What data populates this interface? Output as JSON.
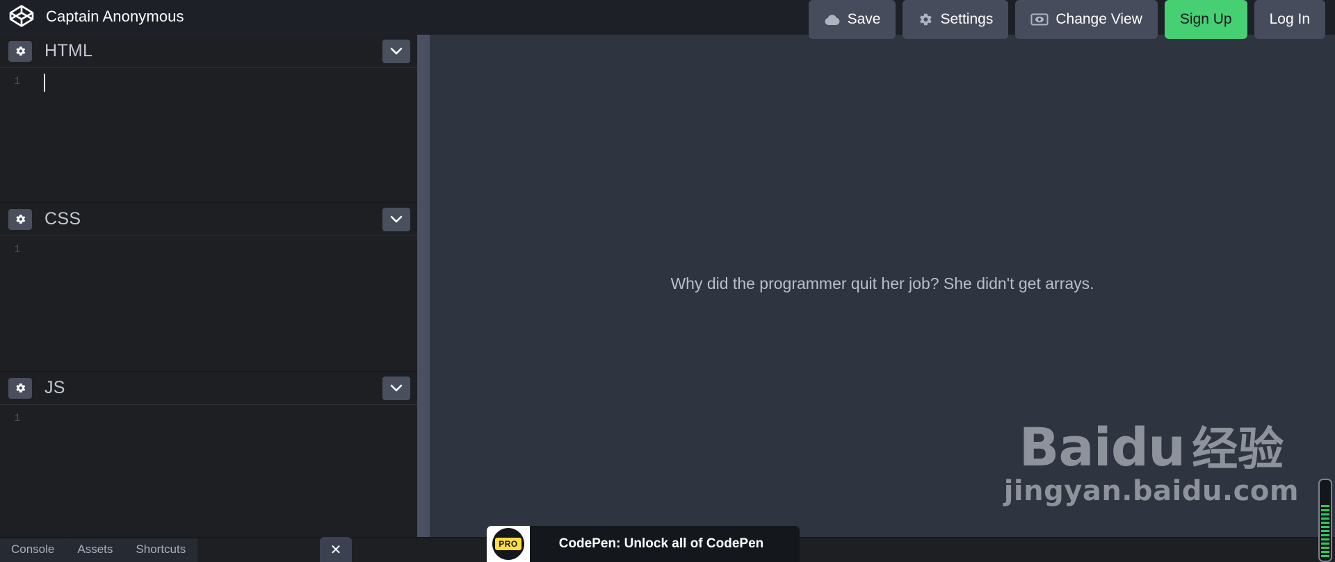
{
  "app": {
    "brand_title": "Captain Anonymous",
    "logo_icon": "codepen-logo-icon"
  },
  "toolbar": {
    "buttons": [
      {
        "label": "Save",
        "icon": "cloud-icon",
        "style": "default"
      },
      {
        "label": "Settings",
        "icon": "gear-icon",
        "style": "default"
      },
      {
        "label": "Change View",
        "icon": "eye-icon",
        "style": "default"
      },
      {
        "label": "Sign Up",
        "icon": "",
        "style": "green"
      },
      {
        "label": "Log In",
        "icon": "",
        "style": "default"
      }
    ],
    "accent_green": "#47cf73",
    "button_bg": "#474c5c"
  },
  "editors": {
    "panels": [
      {
        "title": "HTML",
        "settings_icon": "gear-icon",
        "collapse_icon": "chevron-down-icon",
        "line_number": "1",
        "code": "",
        "has_caret": true
      },
      {
        "title": "CSS",
        "settings_icon": "gear-icon",
        "collapse_icon": "chevron-down-icon",
        "line_number": "1",
        "code": "",
        "has_caret": false
      },
      {
        "title": "JS",
        "settings_icon": "gear-icon",
        "collapse_icon": "chevron-down-icon",
        "line_number": "1",
        "code": "",
        "has_caret": false
      }
    ]
  },
  "preview": {
    "joke_text": "Why did the programmer quit her job? She didn't get arrays.",
    "background": "#2e3440"
  },
  "watermark": {
    "brand": "Bai",
    "brand_tail": "du",
    "chinese": "经验",
    "url": "jingyan.baidu.com"
  },
  "bottom_bar": {
    "tabs": [
      {
        "label": "Console"
      },
      {
        "label": "Assets"
      },
      {
        "label": "Shortcuts"
      }
    ]
  },
  "promo": {
    "badge_text": "PRO",
    "message": "CodePen: Unlock all of CodePen",
    "close_icon": "close-icon",
    "close_label": "✕",
    "badge_color": "#ffdd40"
  },
  "scroll_indicator": {
    "name": "green-striped-scroll-indicator",
    "color": "#2ecc5f"
  }
}
